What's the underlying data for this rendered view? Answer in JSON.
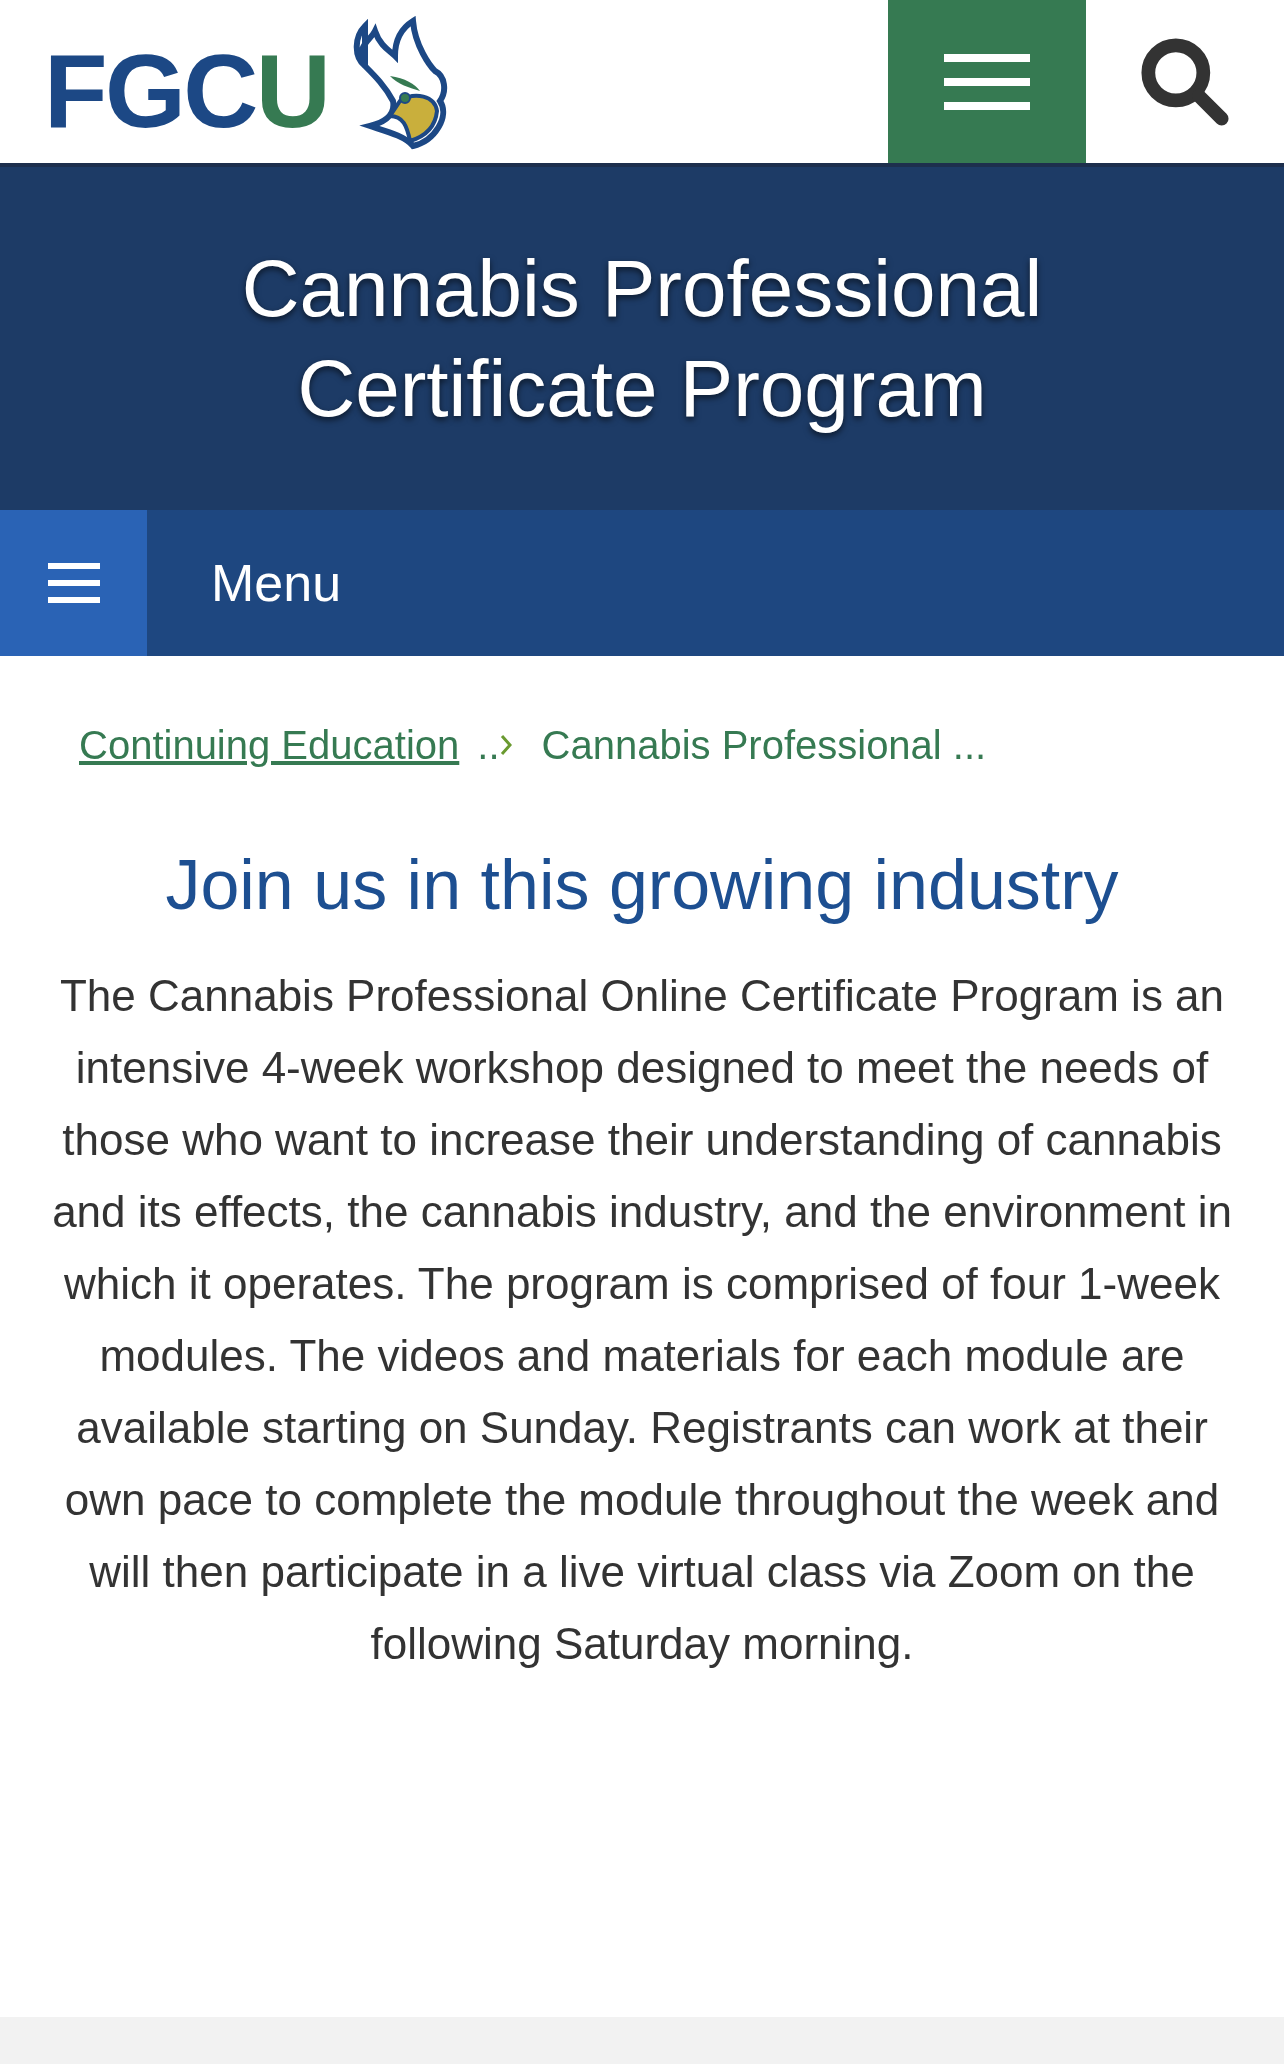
{
  "header": {
    "logo": {
      "letters_primary": "FGC",
      "letters_accent": "U"
    }
  },
  "banner": {
    "title": "Cannabis Professional Certificate Program"
  },
  "menu_bar": {
    "label": "Menu"
  },
  "breadcrumb": {
    "items": [
      {
        "label": "Continuing Education",
        "kind": "link"
      },
      {
        "label": "Cannabis Professional ...",
        "kind": "current"
      }
    ],
    "separator": ".."
  },
  "content": {
    "heading": "Join us in this growing industry",
    "body": "The Cannabis Professional Online Certificate Program is an intensive 4-week workshop designed to meet the needs of those who want to increase their understanding of cannabis and its effects, the cannabis industry, and the environment in which it operates. The program is comprised of four 1-week modules. The videos and materials for each module are available starting on Sunday. Registrants can work at their own pace to complete the module throughout the week and will then participate in a live virtual class via Zoom on the following Saturday morning."
  }
}
